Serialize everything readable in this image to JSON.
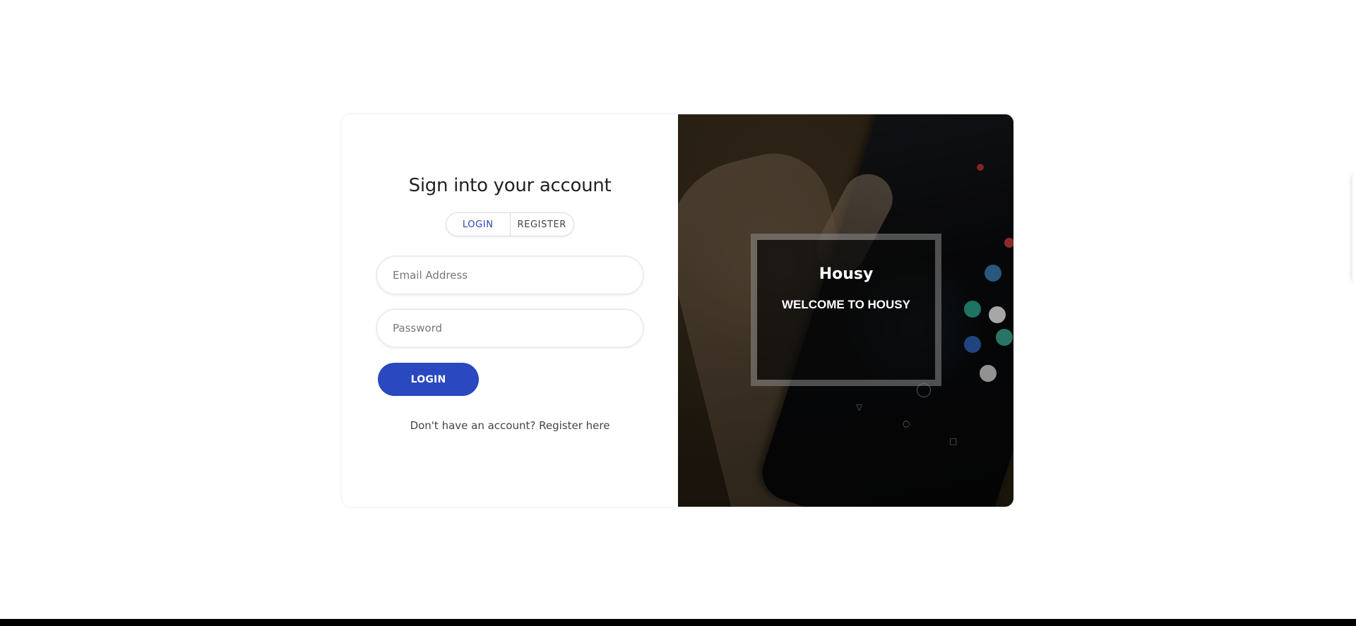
{
  "login_form": {
    "title": "Sign into your account",
    "tabs": [
      {
        "label": "LOGIN",
        "active": true
      },
      {
        "label": "REGISTER",
        "active": false
      }
    ],
    "email": {
      "placeholder": "Email Address",
      "value": ""
    },
    "password": {
      "placeholder": "Password",
      "value": ""
    },
    "submit_label": "LOGIN",
    "register_prompt": "Don't have an account? Register here"
  },
  "promo": {
    "brand": "Housy",
    "welcome": "WELCOME TO HOUSY"
  },
  "colors": {
    "accent": "#2a48bf",
    "active_tab_text": "#2b45b8",
    "page_background": "#ffffff"
  }
}
